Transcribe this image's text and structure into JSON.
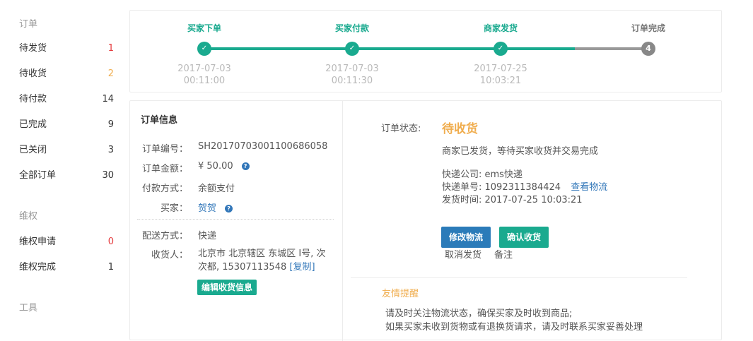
{
  "sidebar": {
    "orders_title": "订单",
    "orders": [
      {
        "label": "待发货",
        "count": "1"
      },
      {
        "label": "待收货",
        "count": "2"
      },
      {
        "label": "待付款",
        "count": "14"
      },
      {
        "label": "已完成",
        "count": "9"
      },
      {
        "label": "已关闭",
        "count": "3"
      },
      {
        "label": "全部订单",
        "count": "30"
      }
    ],
    "rights_title": "维权",
    "rights": [
      {
        "label": "维权申请",
        "count": "0"
      },
      {
        "label": "维权完成",
        "count": "1"
      }
    ],
    "tools_title": "工具"
  },
  "progress": {
    "steps": [
      {
        "label": "买家下单",
        "date": "2017-07-03",
        "time": "00:11:00",
        "mark": "✓"
      },
      {
        "label": "买家付款",
        "date": "2017-07-03",
        "time": "00:11:30",
        "mark": "✓"
      },
      {
        "label": "商家发货",
        "date": "2017-07-25",
        "time": "10:03:21",
        "mark": "✓"
      },
      {
        "label": "订单完成",
        "date": "",
        "time": "",
        "mark": "4"
      }
    ]
  },
  "order_info": {
    "title": "订单信息",
    "number_label": "订单编号：",
    "number": "SH20170703001100686058",
    "amount_label": "订单金额：",
    "amount": "¥ 50.00",
    "pay_label": "付款方式：",
    "pay": "余额支付",
    "buyer_label": "买家：",
    "buyer": "贺贺",
    "ship_label": "配送方式：",
    "ship": "快递",
    "receiver_label": "收货人：",
    "address": "北京市 北京辖区 东城区 I号, 次次都, 15307113548",
    "copy_link": "[复制]",
    "edit_button": "编辑收货信息",
    "help_icon": "?"
  },
  "status": {
    "label": "订单状态:",
    "value": "待收货",
    "desc": "商家已发货，等待买家收货并交易完成",
    "company": "快递公司: ems快递",
    "tracking": "快递单号: 1092311384424",
    "view_logistics": "查看物流",
    "ship_time": "发货时间: 2017-07-25 10:03:21",
    "modify_button": "修改物流",
    "confirm_button": "确认收货",
    "cancel_link": "取消发货",
    "note_link": "备注"
  },
  "tips": {
    "title": "友情提醒",
    "line1": "请及时关注物流状态，确保买家及时收到商品;",
    "line2": "如果买家未收到货物或有退换货请求，请及时联系买家妥善处理"
  },
  "colors": {
    "accent": "#1aaa8f",
    "orange": "#f0ad4e",
    "red": "#e4393c",
    "link": "#3277b9",
    "pending": "#888888"
  }
}
